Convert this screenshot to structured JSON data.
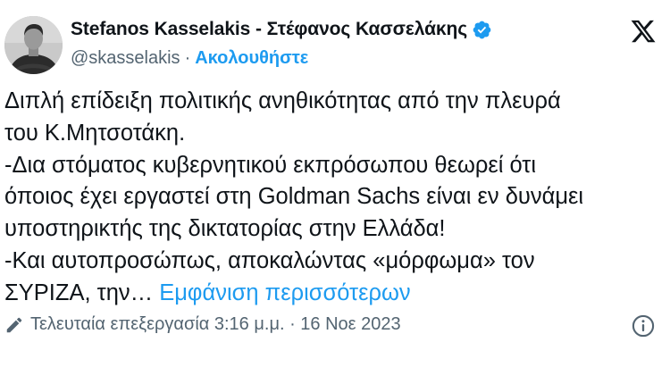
{
  "author": {
    "display_name": "Stefanos Kasselakis - Στέφανος Κασσελάκης",
    "handle": "@skasselakis",
    "separator": "·",
    "follow_label": "Ακολουθήστε"
  },
  "tweet": {
    "lines": [
      "Διπλή επίδειξη πολιτικής ανηθικότητας από την πλευρά",
      "του Κ.Μητσοτάκη.",
      "-Δια στόματος κυβερνητικού εκπρόσωπου θεωρεί ότι",
      "όποιος έχει εργαστεί στη Goldman Sachs είναι εν δυνάμει",
      "υποστηρικτής της δικτατορίας στην Ελλάδα!",
      "-Και αυτοπροσώπως, αποκαλώντας «μόρφωμα» τον",
      "ΣΥΡΙΖΑ, την… "
    ],
    "show_more_label": "Εμφάνιση περισσότερων"
  },
  "footer": {
    "edited_label": "Τελευταία επεξεργασία 3:16 μ.μ. · 16 Νοε 2023"
  },
  "icons": {
    "verified": "verified-badge-icon",
    "logo": "x-logo-icon",
    "edit": "pencil-icon",
    "info": "info-icon"
  },
  "colors": {
    "accent": "#1d9bf0",
    "text": "#0f1419",
    "secondary": "#536471"
  }
}
